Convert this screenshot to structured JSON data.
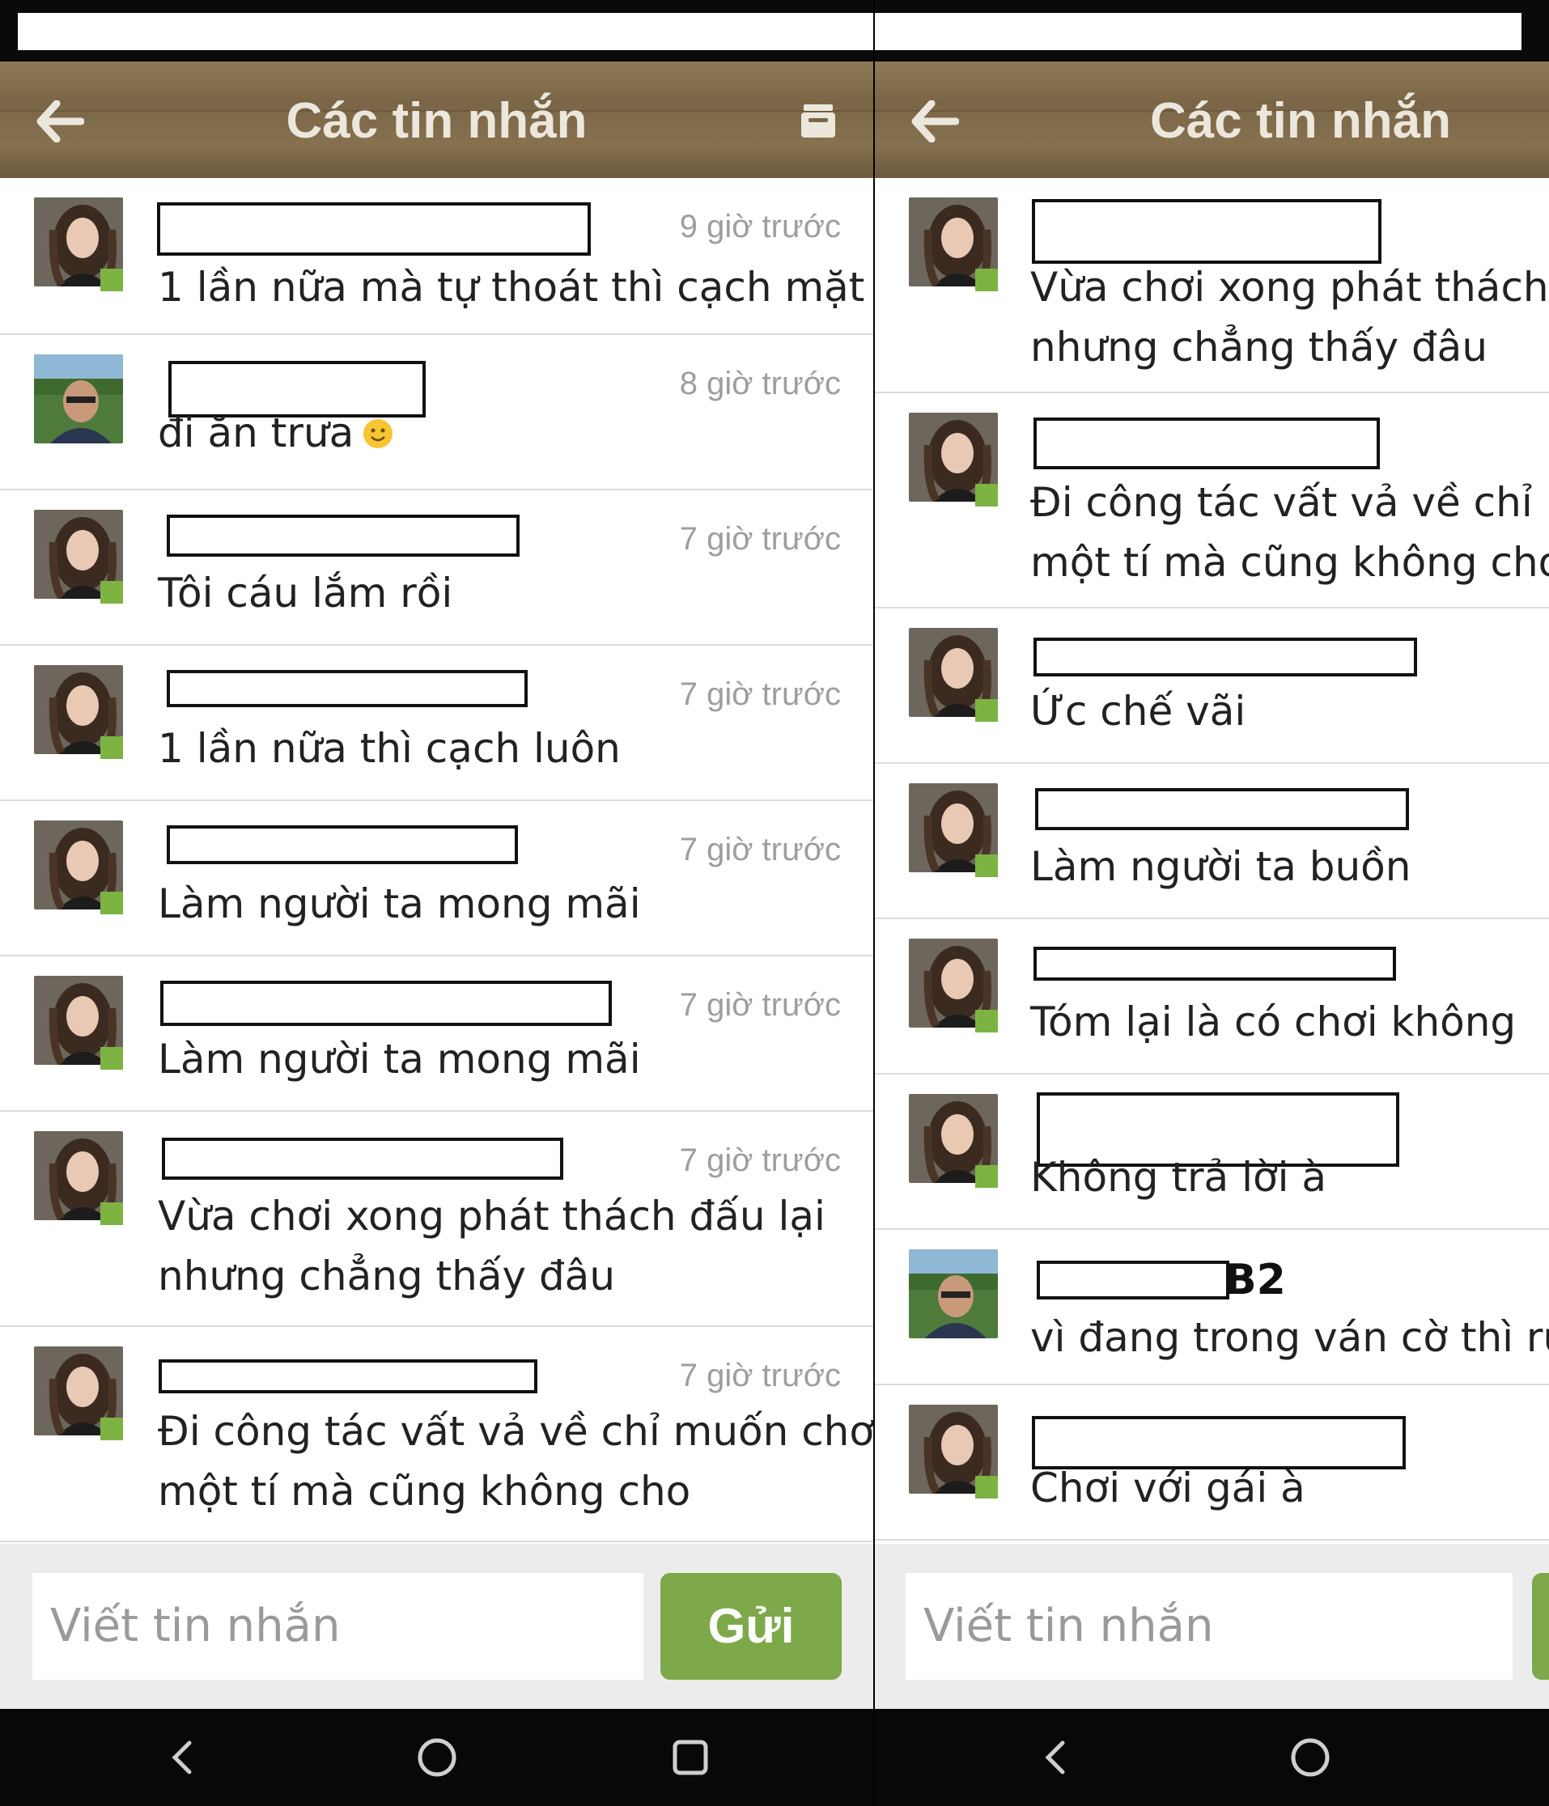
{
  "colors": {
    "accent": "#7ea94a",
    "online": "#7cb342",
    "header": "#7a6546",
    "time": "#9e9e9e"
  },
  "icons": {
    "back": "arrow-left-icon",
    "archive": "archive-box-icon",
    "nav_back": "chevron-left-icon",
    "nav_home": "circle-home-icon",
    "nav_recent": "square-recent-icon",
    "online": "online-dot-icon",
    "emoji": "smiley-icon"
  },
  "left": {
    "title": "Các tin nhắn",
    "input_placeholder": "Viết tin nhắn",
    "send_label": "Gửi",
    "messages": [
      {
        "time": "9 giờ trước",
        "lines": [
          "1 lần nữa mà tự thoát thì cạch mặt"
        ],
        "avatar": "girl"
      },
      {
        "time": "8 giờ trước",
        "lines": [
          "đi ăn trưa"
        ],
        "avatar": "man",
        "emoji": true
      },
      {
        "time": "7 giờ trước",
        "lines": [
          "Tôi cáu lắm rồi"
        ],
        "avatar": "girl"
      },
      {
        "time": "7 giờ trước",
        "lines": [
          "1 lần nữa thì cạch luôn"
        ],
        "avatar": "girl"
      },
      {
        "time": "7 giờ trước",
        "lines": [
          "Làm người ta mong mãi"
        ],
        "avatar": "girl"
      },
      {
        "time": "7 giờ trước",
        "lines": [
          "Làm người ta mong mãi"
        ],
        "avatar": "girl"
      },
      {
        "time": "7 giờ trước",
        "lines": [
          "Vừa chơi xong phát thách đấu lại",
          "nhưng chẳng thấy đâu"
        ],
        "avatar": "girl"
      },
      {
        "time": "7 giờ trước",
        "lines": [
          "Đi công tác vất vả về chỉ muốn chơi",
          "một tí mà cũng không cho"
        ],
        "avatar": "girl"
      }
    ]
  },
  "right": {
    "title": "Các tin nhắn",
    "input_placeholder": "Viết tin nhắn",
    "messages": [
      {
        "lines": [
          "Vừa chơi xong phát thách đ",
          "nhưng chẳng thấy đâu"
        ],
        "avatar": "girl"
      },
      {
        "lines": [
          "Đi công tác vất vả về chỉ mu",
          "một tí mà cũng không cho"
        ],
        "avatar": "girl"
      },
      {
        "lines": [
          "Ức chế vãi"
        ],
        "avatar": "girl"
      },
      {
        "lines": [
          "Làm người ta buồn"
        ],
        "avatar": "girl"
      },
      {
        "lines": [
          "Tóm lại là có chơi không"
        ],
        "avatar": "girl"
      },
      {
        "lines": [
          "Không trả lời à"
        ],
        "avatar": "girl"
      },
      {
        "lines": [
          "vì đang trong ván cờ thì rủ sa"
        ],
        "avatar": "man",
        "name": "B2"
      },
      {
        "lines": [
          "Chơi với gái à"
        ],
        "avatar": "girl"
      }
    ]
  }
}
